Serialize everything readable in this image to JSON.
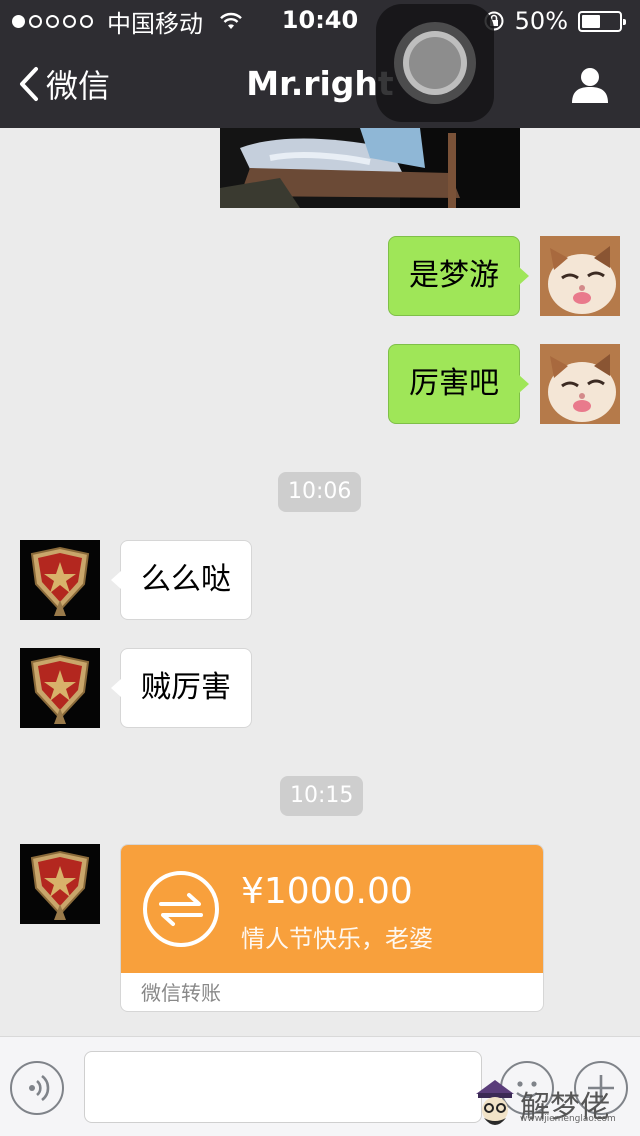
{
  "status_bar": {
    "signal_dots": [
      true,
      false,
      false,
      false,
      false
    ],
    "carrier": "中国移动",
    "time": "10:40",
    "battery": "50%",
    "battery_level": 0.5
  },
  "nav": {
    "back_label": "微信",
    "title": "Mr.right"
  },
  "messages": [
    {
      "kind": "image"
    },
    {
      "kind": "text",
      "dir": "out",
      "text": "是梦游"
    },
    {
      "kind": "text",
      "dir": "out",
      "text": "厉害吧"
    },
    {
      "kind": "timestamp",
      "text": "10:06"
    },
    {
      "kind": "text",
      "dir": "in",
      "text": "么么哒"
    },
    {
      "kind": "text",
      "dir": "in",
      "text": "贼厉害"
    },
    {
      "kind": "timestamp",
      "text": "10:15"
    },
    {
      "kind": "transfer",
      "dir": "in",
      "amount": "¥1000.00",
      "note": "情人节快乐，老婆",
      "footer": "微信转账"
    }
  ],
  "watermark": {
    "text": "解梦佬",
    "url": "www.jiemenglao.com"
  },
  "colors": {
    "header": "#2e2d32",
    "out_bubble": "#9fe658",
    "transfer": "#f8a03c",
    "background": "#ebebeb"
  }
}
